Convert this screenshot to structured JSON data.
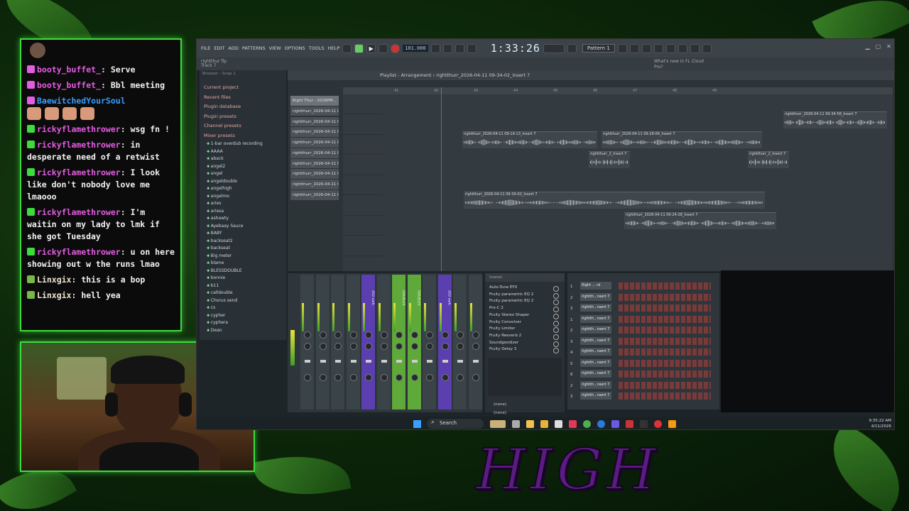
{
  "chat": {
    "messages": [
      {
        "user": "booty_buffet_",
        "color": "#e45ce2",
        "text": "Serve"
      },
      {
        "user": "booty_buffet_",
        "color": "#e45ce2",
        "text": "Bbl meeting"
      },
      {
        "user": "BaewitchedYourSoul",
        "color": "#3b9cff",
        "text": ""
      },
      {
        "user": "rickyflamethrower",
        "color": "#e45ce2",
        "text": "wsg fn !"
      },
      {
        "user": "rickyflamethrower",
        "color": "#e45ce2",
        "text": "in desperate need of a retwist"
      },
      {
        "user": "rickyflamethrower",
        "color": "#e45ce2",
        "text": "I look like don't nobody love me lmaooo"
      },
      {
        "user": "rickyflamethrower",
        "color": "#e45ce2",
        "text": "I'm waitin on my lady to lmk if she got Tuesday"
      },
      {
        "user": "rickyflamethrower",
        "color": "#e45ce2",
        "text": "u on here showing out w the runs lmao"
      },
      {
        "user": "Linxgix",
        "color": "#f0e6d2",
        "text": "this is a bop"
      },
      {
        "user": "Linxgix",
        "color": "#f0e6d2",
        "text": "hell yea"
      }
    ]
  },
  "fl": {
    "menu": [
      "FILE",
      "EDIT",
      "ADD",
      "PATTERNS",
      "VIEW",
      "OPTIONS",
      "TOOLS",
      "HELP"
    ],
    "bpm": "101.000",
    "time": "1:33:26",
    "pattern": "Pattern 1",
    "hint_file": "rightthur flp",
    "hint_track": "Track 7",
    "whats_new": "What's new in FL Cloud Pro?",
    "browser_head": "Browser - Snap 1",
    "playlist_title": "Playlist - Arrangement › rightthurr_2026-04-11 09-34-02_Insert 7",
    "browser_top": [
      "Current project",
      "Recent files",
      "Plugin database",
      "Plugin presets",
      "Channel presets",
      "Mixer presets"
    ],
    "browser_items": [
      "1-bar overdub recording",
      "AAAA",
      "aback",
      "angel2",
      "angel",
      "angeldouble",
      "angelhigh",
      "angelmo",
      "aries",
      "ariesa",
      "ashawty",
      "Ayebaay Sauce",
      "BABY",
      "backseat2",
      "backseat",
      "Big meter",
      "blame",
      "BLESSDOUBLE",
      "bonnie",
      "b11",
      "calldouble",
      "Chorus send",
      "cs",
      "cypher",
      "cyphera",
      "Dean"
    ],
    "patterns": [
      "Right Thur - 101BPM...",
      "rightthurr_2026-04-11 0...",
      "rightthurr_2026-04-11 0...",
      "rightthurr_2026-04-11 0...",
      "rightthurr_2026-04-11 0...",
      "rightthurr_2026-04-11 0...",
      "rightthurr_2026-04-11 0...",
      "rightthurr_2026-04-11 0...",
      "rightthurr_2026-04-11 0...",
      "rightthurr_2026-04-11 0..."
    ],
    "ruler": [
      "41",
      "42",
      "43",
      "44",
      "45",
      "46",
      "47",
      "48",
      "49"
    ],
    "clips": [
      {
        "name": "rightthurr_2026-04-11 09-34-58_Insert 7"
      },
      {
        "name": "rightthurr_2026-04-11 09-19-13_Insert 7"
      },
      {
        "name": "rightthurr_2026-04-11 09-28-06_Insert 7"
      },
      {
        "name": "rightthurr_2_Insert 7"
      },
      {
        "name": "rightthurr_2_Insert 7"
      },
      {
        "name": "rightthurr_2026-04-11 09-34-02_Insert 7"
      },
      {
        "name": "rightthurr_2026-04-11 09-24-28_Insert 7"
      }
    ],
    "mixer_labels": [
      "2D2 verb",
      "DOUBLES",
      "DOUBLES",
      "2D2 verb"
    ],
    "fx_head": "(none)",
    "fx_slots": [
      "Auto-Tune EFX",
      "Fruity parametric EQ 2",
      "Fruity parametric EQ 2",
      "Pro-C 2",
      "Fruity Stereo Shaper",
      "Fruity Convolver",
      "Fruity Limiter",
      "Fruity Reeverb 2",
      "Soundgoodizer",
      "Fruity Delay 3"
    ],
    "fx_none": "(none)",
    "fx_none2": "(none)",
    "rack": [
      {
        "num": "1",
        "name": "Right ... rd"
      },
      {
        "num": "2",
        "name": "rightth...nsert 7"
      },
      {
        "num": "3",
        "name": "rightth...nsert 7"
      },
      {
        "num": "1",
        "name": "rightth...nsert 7"
      },
      {
        "num": "2",
        "name": "rightth...nsert 7"
      },
      {
        "num": "3",
        "name": "rightth...nsert 7"
      },
      {
        "num": "4",
        "name": "rightth...nsert 7"
      },
      {
        "num": "5",
        "name": "rightth...nsert 7"
      },
      {
        "num": "6",
        "name": "rightth...nsert 7"
      },
      {
        "num": "2",
        "name": "rightth...nsert 7"
      },
      {
        "num": "3",
        "name": "rightth...nsert 7"
      }
    ]
  },
  "taskbar": {
    "search": "Search",
    "time": "9:35:22 AM",
    "date": "4/11/2026"
  },
  "overlay": {
    "title": "HIGH VIBES"
  }
}
